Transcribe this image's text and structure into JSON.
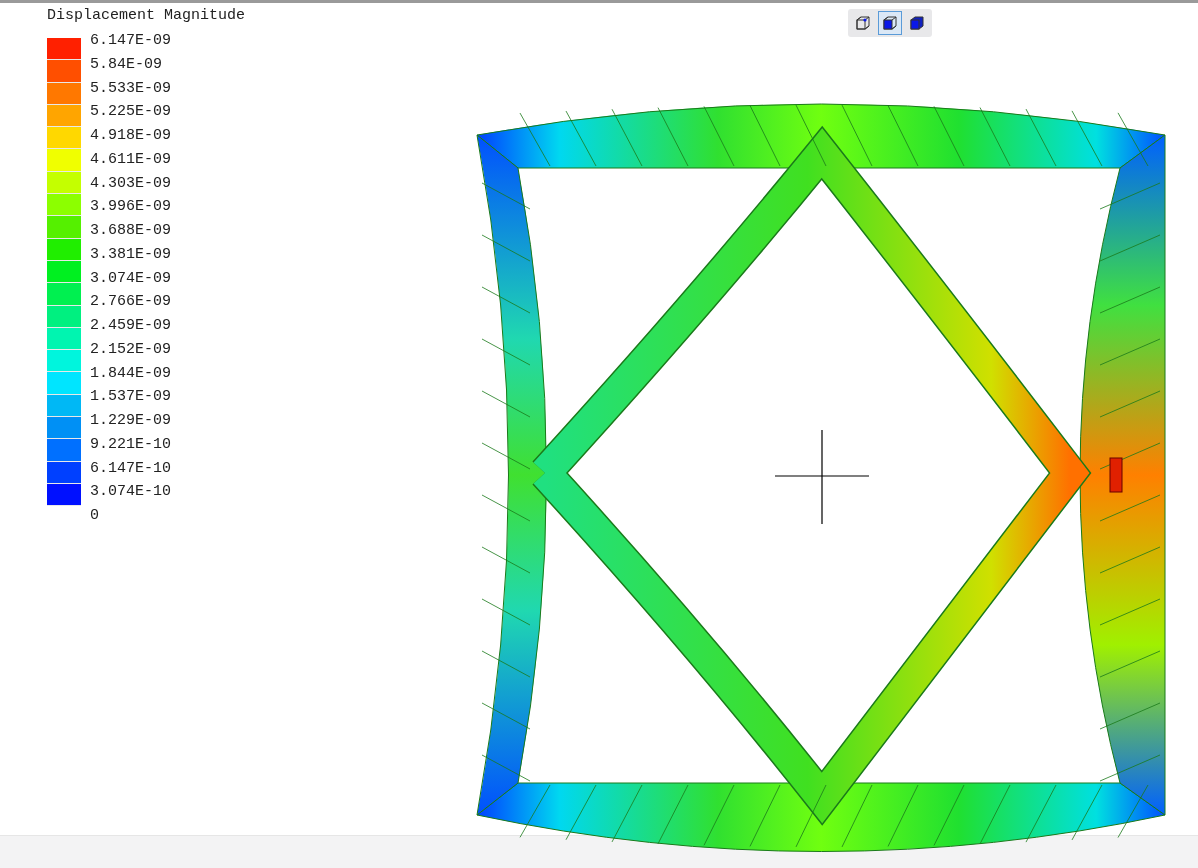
{
  "legend": {
    "title": "Displacement Magnitude",
    "bands": [
      {
        "color": "#ff2000"
      },
      {
        "color": "#ff4f00"
      },
      {
        "color": "#ff7800"
      },
      {
        "color": "#ffa500"
      },
      {
        "color": "#ffd800"
      },
      {
        "color": "#f0ff00"
      },
      {
        "color": "#c4ff00"
      },
      {
        "color": "#8cff00"
      },
      {
        "color": "#55f000"
      },
      {
        "color": "#20ee00"
      },
      {
        "color": "#00f020"
      },
      {
        "color": "#00f050"
      },
      {
        "color": "#00f080"
      },
      {
        "color": "#00f5b0"
      },
      {
        "color": "#00f5dd"
      },
      {
        "color": "#00e5ff"
      },
      {
        "color": "#00b8f5"
      },
      {
        "color": "#0090f5"
      },
      {
        "color": "#0070ff"
      },
      {
        "color": "#0040ff"
      },
      {
        "color": "#0010ff"
      }
    ],
    "ticks": [
      "6.147E-09",
      "5.84E-09",
      "5.533E-09",
      "5.225E-09",
      "4.918E-09",
      "4.611E-09",
      "4.303E-09",
      "3.996E-09",
      "3.688E-09",
      "3.381E-09",
      "3.074E-09",
      "2.766E-09",
      "2.459E-09",
      "2.152E-09",
      "1.844E-09",
      "1.537E-09",
      "1.229E-09",
      "9.221E-10",
      "6.147E-10",
      "3.074E-10",
      "0"
    ]
  },
  "view_buttons": [
    {
      "kind": "wireframe",
      "selected": false
    },
    {
      "kind": "shaded-edges",
      "selected": true
    },
    {
      "kind": "shaded",
      "selected": false
    }
  ]
}
